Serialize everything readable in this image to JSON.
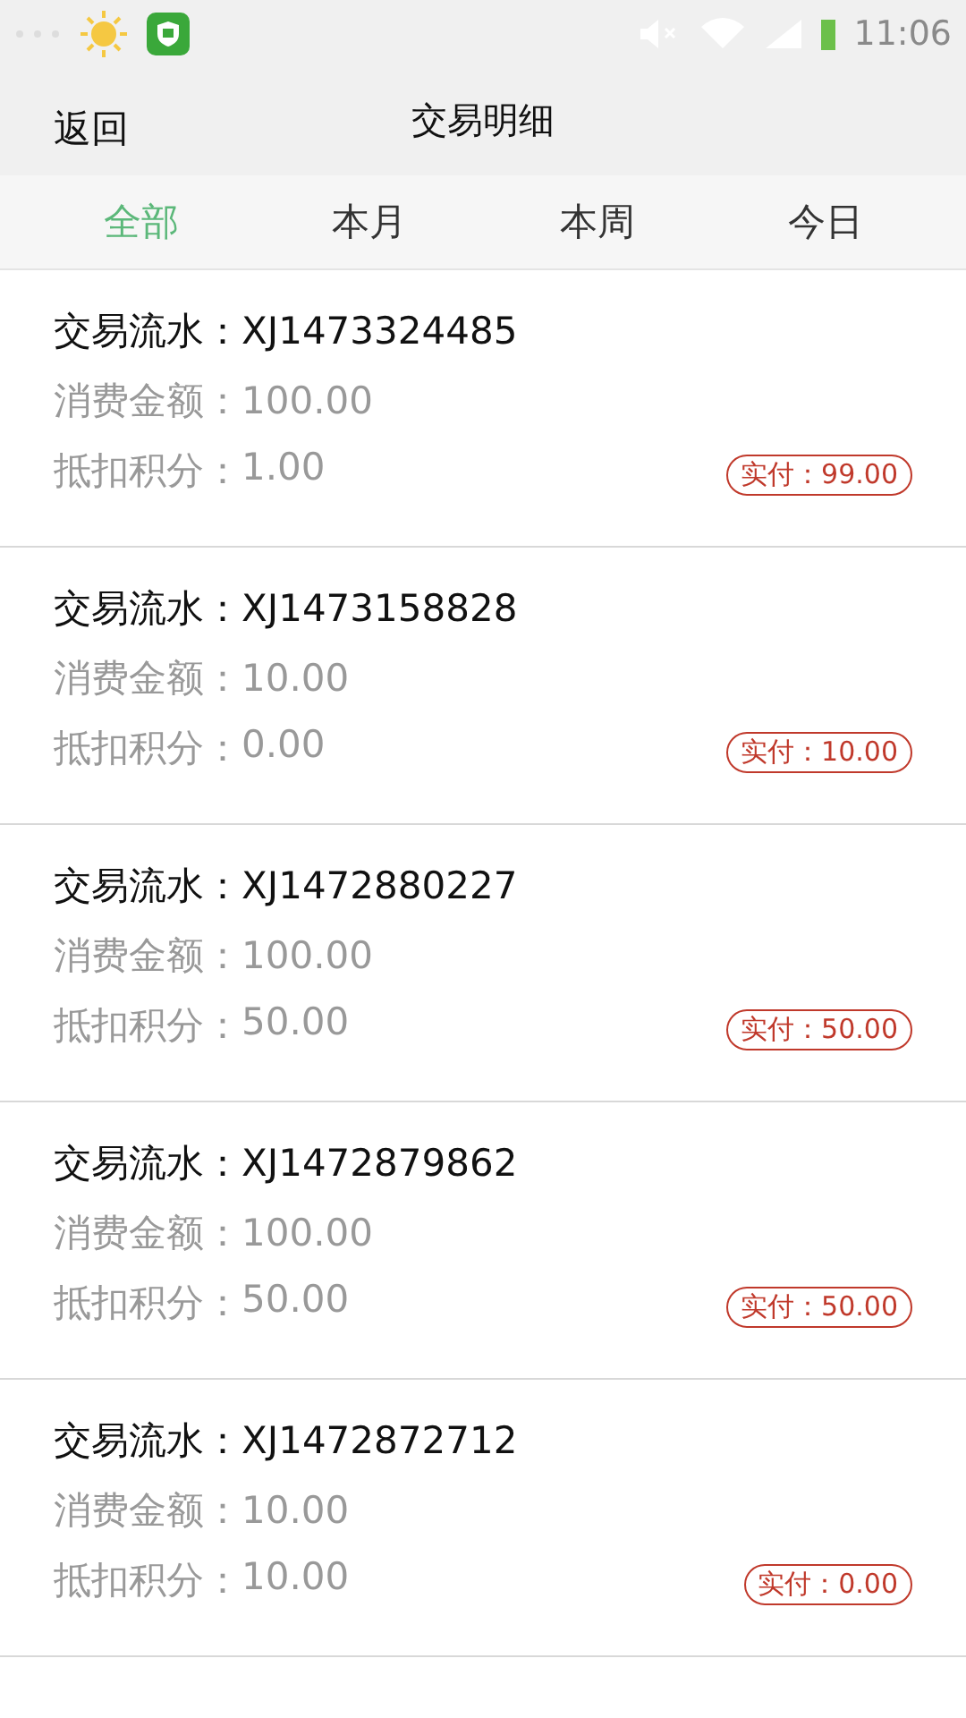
{
  "status_bar": {
    "time": "11:06"
  },
  "header": {
    "back": "返回",
    "title": "交易明细"
  },
  "tabs": [
    {
      "label": "全部",
      "selected": true
    },
    {
      "label": "本月",
      "selected": false
    },
    {
      "label": "本周",
      "selected": false
    },
    {
      "label": "今日",
      "selected": false
    }
  ],
  "transactions": [
    {
      "serial_label": "交易流水：",
      "serial": "XJ1473324485",
      "amount_label": "消费金额：",
      "amount": "100.00",
      "points_label": "抵扣积分：",
      "points": "1.00",
      "paid": "实付：99.00"
    },
    {
      "serial_label": "交易流水：",
      "serial": "XJ1473158828",
      "amount_label": "消费金额：",
      "amount": "10.00",
      "points_label": "抵扣积分：",
      "points": "0.00",
      "paid": "实付：10.00"
    },
    {
      "serial_label": "交易流水：",
      "serial": "XJ1472880227",
      "amount_label": "消费金额：",
      "amount": "100.00",
      "points_label": "抵扣积分：",
      "points": "50.00",
      "paid": "实付：50.00"
    },
    {
      "serial_label": "交易流水：",
      "serial": "XJ1472879862",
      "amount_label": "消费金额：",
      "amount": "100.00",
      "points_label": "抵扣积分：",
      "points": "50.00",
      "paid": "实付：50.00"
    },
    {
      "serial_label": "交易流水：",
      "serial": "XJ1472872712",
      "amount_label": "消费金额：",
      "amount": "10.00",
      "points_label": "抵扣积分：",
      "points": "10.00",
      "paid": "实付：0.00"
    }
  ]
}
